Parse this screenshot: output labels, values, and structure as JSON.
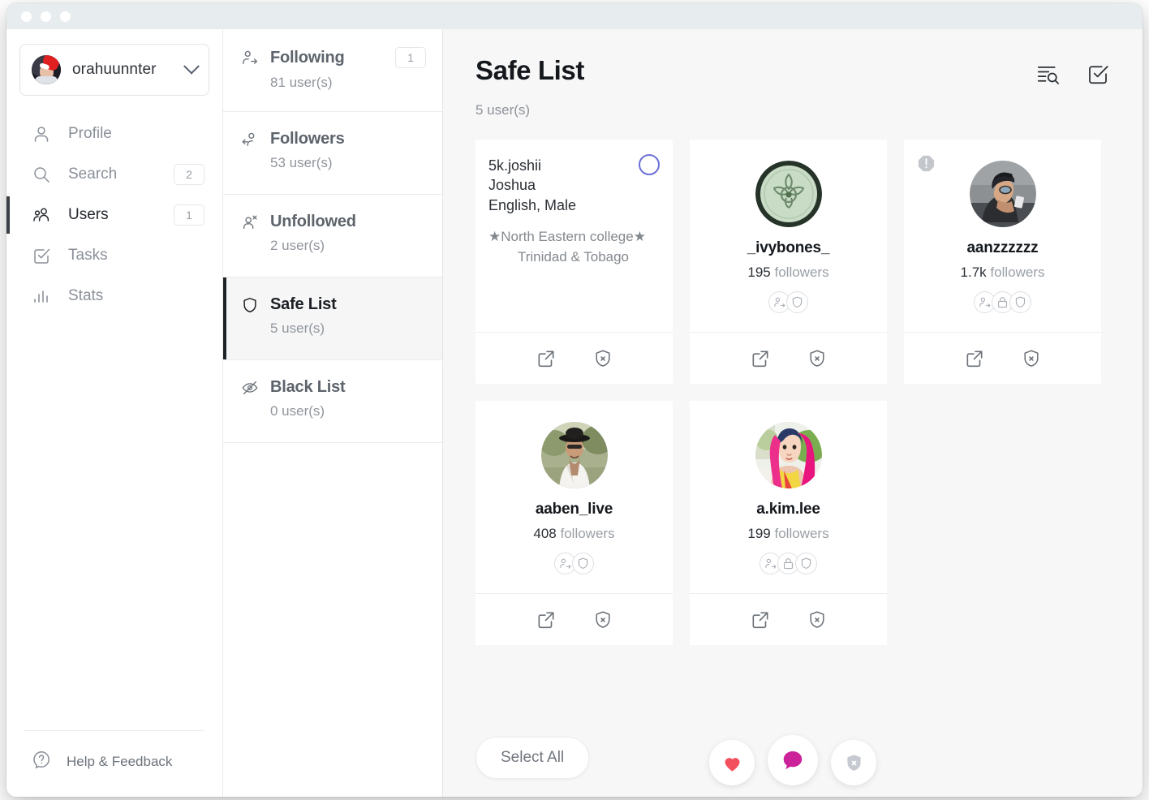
{
  "window": {
    "titlebar_dots": 3
  },
  "sidebar": {
    "account": {
      "name": "orahuunnter",
      "avatar_icon": "user-avatar",
      "dropdown_icon": "chevron-down-icon"
    },
    "items": [
      {
        "label": "Profile",
        "icon": "person-icon",
        "badge": "",
        "active": false
      },
      {
        "label": "Search",
        "icon": "magnifier-icon",
        "badge": "2",
        "active": false
      },
      {
        "label": "Users",
        "icon": "people-icon",
        "badge": "1",
        "active": true
      },
      {
        "label": "Tasks",
        "icon": "check-square-icon",
        "badge": "",
        "active": false
      },
      {
        "label": "Stats",
        "icon": "bar-chart-icon",
        "badge": "",
        "active": false
      }
    ],
    "footer": {
      "label": "Help & Feedback",
      "icon": "question-bubble-icon"
    }
  },
  "list_column": {
    "items": [
      {
        "title": "Following",
        "count": "81 user(s)",
        "icon": "person-arrow-right-icon",
        "badge": "1",
        "active": false
      },
      {
        "title": "Followers",
        "count": "53 user(s)",
        "icon": "person-arrow-left-icon",
        "badge": "",
        "active": false
      },
      {
        "title": "Unfollowed",
        "count": "2 user(s)",
        "icon": "person-x-icon",
        "badge": "",
        "active": false
      },
      {
        "title": "Safe List",
        "count": "5 user(s)",
        "icon": "shield-icon",
        "badge": "",
        "active": true
      },
      {
        "title": "Black List",
        "count": "0 user(s)",
        "icon": "eye-off-icon",
        "badge": "",
        "active": false
      }
    ]
  },
  "main": {
    "title": "Safe List",
    "subtitle": "5 user(s)",
    "header_actions": [
      {
        "name": "sort-search-icon",
        "label": "Sort and search"
      },
      {
        "name": "select-mode-icon",
        "label": "Selection mode"
      }
    ],
    "cards": [
      {
        "type": "text",
        "username": "5k.joshii",
        "full_name": "Joshua",
        "meta": "English, Male",
        "bio_lines": [
          "★North Eastern college★",
          "Trinidad & Tobago"
        ],
        "selected_circle": true,
        "alert": false,
        "flags": [],
        "footer_actions": [
          "open-external-icon",
          "shield-x-icon"
        ]
      },
      {
        "type": "avatar",
        "username": "_ivybones_",
        "followers_count": "195",
        "followers_label": "followers",
        "avatar_kind": "green-leaf-emblem",
        "alert": false,
        "flags": [
          "following-icon",
          "shield-icon"
        ],
        "footer_actions": [
          "open-external-icon",
          "shield-x-icon"
        ]
      },
      {
        "type": "avatar",
        "username": "aanzzzzzz",
        "followers_count": "1.7k",
        "followers_label": "followers",
        "avatar_kind": "man-beanie-photo",
        "alert": true,
        "flags": [
          "following-icon",
          "lock-icon",
          "shield-icon"
        ],
        "footer_actions": [
          "open-external-icon",
          "shield-x-icon"
        ]
      },
      {
        "type": "avatar",
        "username": "aaben_live",
        "followers_count": "408",
        "followers_label": "followers",
        "avatar_kind": "man-white-shirt-photo",
        "alert": false,
        "flags": [
          "following-icon",
          "shield-icon"
        ],
        "footer_actions": [
          "open-external-icon",
          "shield-x-icon"
        ]
      },
      {
        "type": "avatar",
        "username": "a.kim.lee",
        "followers_count": "199",
        "followers_label": "followers",
        "avatar_kind": "woman-pink-hair-photo",
        "alert": false,
        "flags": [
          "following-icon",
          "lock-icon",
          "shield-icon"
        ],
        "footer_actions": [
          "open-external-icon",
          "shield-x-icon"
        ]
      }
    ]
  },
  "bottom_bar": {
    "select_all_label": "Select All",
    "actions": [
      {
        "name": "like-button",
        "icon": "heart-icon",
        "color": "#f4515e"
      },
      {
        "name": "comment-button",
        "icon": "bubble-icon",
        "color": "#cc2299"
      },
      {
        "name": "unsafe-button",
        "icon": "shield-x-icon",
        "color": "#c6cad0"
      }
    ]
  },
  "colors": {
    "titlebar": "#e7ecef",
    "main_bg": "#f7f7f7",
    "accent_selection": "#6b6fd8",
    "active_indicator": "#202326"
  }
}
